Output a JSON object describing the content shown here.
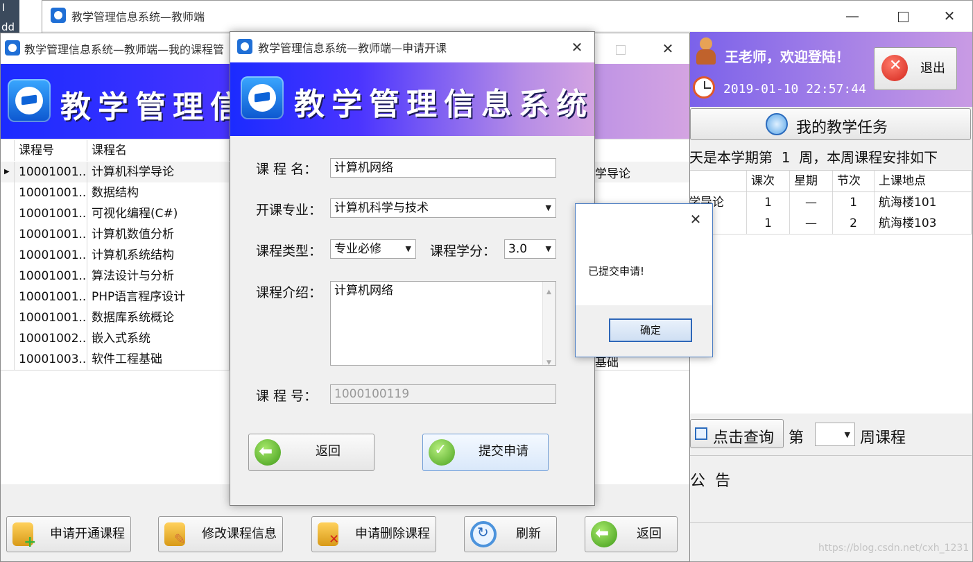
{
  "bg_window": {
    "title": "教学管理信息系统—教师端",
    "left_strip": [
      "I",
      "dd"
    ],
    "welcome": "王老师，欢迎登陆！",
    "datetime": "2019-01-10 22:57:44",
    "logout_label": "退出",
    "tasks_button": "我的教学任务",
    "week_line": "天是本学期第  1  周，本周课程安排如下",
    "schedule": {
      "headers": [
        "课次",
        "星期",
        "节次",
        "上课地点"
      ],
      "rows": [
        {
          "course": "学导论",
          "num": "1",
          "day": "—",
          "section": "1",
          "place": "航海楼101"
        },
        {
          "course": "",
          "num": "1",
          "day": "—",
          "section": "2",
          "place": "航海楼103"
        }
      ]
    },
    "query_button": "点击查询",
    "week_prefix": "第",
    "week_suffix": "周课程",
    "notice": "公  告"
  },
  "course_window": {
    "title": "教学管理信息系统—教师端—我的课程管",
    "banner_title": "教学管理信",
    "columns": [
      "课程号",
      "课程名"
    ],
    "peek_texts": [
      "学导论",
      "基础"
    ],
    "rows": [
      {
        "id": "10001001...",
        "name": "计算机科学导论"
      },
      {
        "id": "10001001...",
        "name": "数据结构"
      },
      {
        "id": "10001001...",
        "name": "可视化编程(C#)"
      },
      {
        "id": "10001001...",
        "name": "计算机数值分析"
      },
      {
        "id": "10001001...",
        "name": "计算机系统结构"
      },
      {
        "id": "10001001...",
        "name": "算法设计与分析"
      },
      {
        "id": "10001001...",
        "name": "PHP语言程序设计"
      },
      {
        "id": "10001001...",
        "name": "数据库系统概论"
      },
      {
        "id": "10001002...",
        "name": "嵌入式系统"
      },
      {
        "id": "10001003...",
        "name": "软件工程基础"
      }
    ],
    "buttons": {
      "apply": "申请开通课程",
      "modify": "修改课程信息",
      "delete": "申请删除课程",
      "refresh": "刷新",
      "back": "返回"
    }
  },
  "apply_dialog": {
    "title": "教学管理信息系统—教师端—申请开课",
    "banner_title": "教学管理信息系统",
    "labels": {
      "course_name": "课 程 名：",
      "major": "开课专业：",
      "type": "课程类型：",
      "credit": "课程学分：",
      "intro": "课程介绍：",
      "course_id": "课 程 号："
    },
    "values": {
      "course_name": "计算机网络",
      "major": "计算机科学与技术",
      "type": "专业必修",
      "credit": "3.0",
      "intro": "计算机网络",
      "course_id": "1000100119"
    },
    "back_button": "返回",
    "submit_button": "提交申请"
  },
  "message_box": {
    "message": "已提交申请!",
    "ok_button": "确定"
  },
  "watermark": "https://blog.csdn.net/cxh_1231",
  "colors": {
    "banner_start": "#1b2bff",
    "banner_end": "#d4a4e2",
    "accent_blue": "#1f6fd6"
  }
}
